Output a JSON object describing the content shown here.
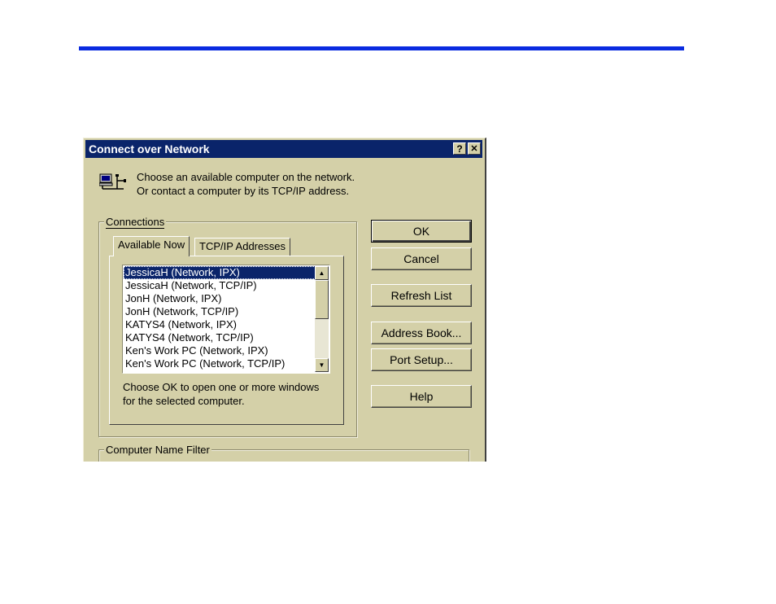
{
  "colors": {
    "accent_rule": "#0a2be0",
    "titlebar": "#0a246a",
    "dialog_face": "#d4d0a8"
  },
  "dialog": {
    "title": "Connect over Network",
    "help_glyph": "?",
    "close_glyph": "✕",
    "intro_line1": "Choose an available computer on the network.",
    "intro_line2": "Or contact a computer by its TCP/IP address.",
    "connections_label": "Connections",
    "tabs": [
      {
        "label": "Available Now"
      },
      {
        "label": "TCP/IP Addresses"
      }
    ],
    "list_items": [
      "JessicaH (Network, IPX)",
      "JessicaH (Network, TCP/IP)",
      "JonH (Network, IPX)",
      "JonH (Network, TCP/IP)",
      "KATYS4 (Network, IPX)",
      "KATYS4 (Network, TCP/IP)",
      "Ken's Work PC (Network, IPX)",
      "Ken's Work PC (Network, TCP/IP)"
    ],
    "selected_item": "JessicaH (Network, IPX)",
    "hint_line1": "Choose OK to open one or more windows",
    "hint_line2": "for the selected computer.",
    "filter_label": "Computer Name Filter",
    "buttons": {
      "ok": "OK",
      "cancel": "Cancel",
      "refresh": "Refresh List",
      "address_book": "Address Book...",
      "port_setup": "Port Setup...",
      "help": "Help"
    }
  }
}
